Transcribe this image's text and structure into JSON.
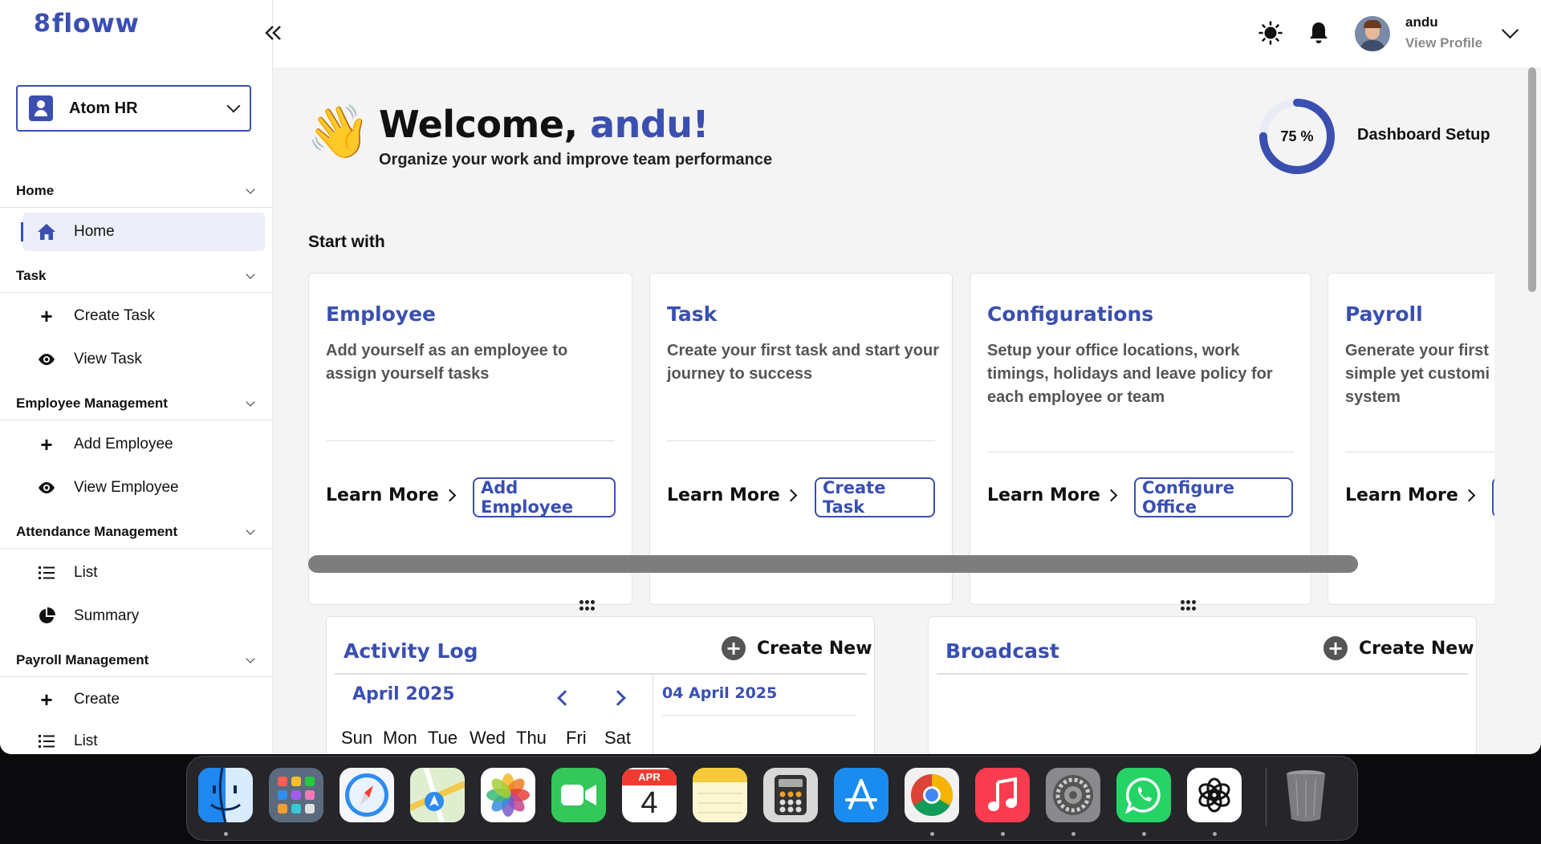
{
  "brand": {
    "mark": "8",
    "name": "floww"
  },
  "org": {
    "name": "Atom HR"
  },
  "sidebar": {
    "sections": [
      {
        "title": "Home",
        "items": [
          {
            "label": "Home",
            "icon": "house-icon"
          }
        ]
      },
      {
        "title": "Task",
        "items": [
          {
            "label": "Create Task",
            "icon": "plus-icon"
          },
          {
            "label": "View Task",
            "icon": "eye-icon"
          }
        ]
      },
      {
        "title": "Employee Management",
        "items": [
          {
            "label": "Add Employee",
            "icon": "plus-icon"
          },
          {
            "label": "View Employee",
            "icon": "eye-icon"
          }
        ]
      },
      {
        "title": "Attendance Management",
        "items": [
          {
            "label": "List",
            "icon": "list-icon"
          },
          {
            "label": "Summary",
            "icon": "pie-chart-icon"
          }
        ]
      },
      {
        "title": "Payroll Management",
        "items": [
          {
            "label": "Create",
            "icon": "plus-icon"
          },
          {
            "label": "List",
            "icon": "list-icon"
          }
        ]
      }
    ]
  },
  "topbar": {
    "user_name": "andu",
    "profile_link": "View Profile",
    "icons": [
      "sun-icon",
      "bell-icon",
      "avatar",
      "chevron-down-icon"
    ]
  },
  "welcome": {
    "greeting": "Welcome, ",
    "user": "andu!",
    "subtitle": "Organize your work and improve team performance",
    "emoji": "👋"
  },
  "setup": {
    "progress_label": "75 %",
    "progress_value": 0.75,
    "label": "Dashboard Setup"
  },
  "start_with": {
    "heading": "Start with",
    "cards": [
      {
        "title": "Employee",
        "desc": "Add yourself as an employee to assign yourself tasks",
        "learn_more": "Learn More",
        "button": "Add Employee"
      },
      {
        "title": "Task",
        "desc": "Create your first task and start your journey to success",
        "learn_more": "Learn More",
        "button": "Create Task"
      },
      {
        "title": "Configurations",
        "desc": "Setup your office locations, work timings, holidays and leave policy for each employee or team",
        "learn_more": "Learn More",
        "button": "Configure Office"
      },
      {
        "title": "Payroll",
        "desc": "Generate your first simple yet customi system",
        "learn_more": "Learn More",
        "button": ""
      }
    ]
  },
  "activity_log": {
    "title": "Activity Log",
    "create_new": "Create New",
    "month": "April 2025",
    "selected_date": "04 April 2025",
    "weekdays": [
      "Sun",
      "Mon",
      "Tue",
      "Wed",
      "Thu",
      "Fri",
      "Sat"
    ]
  },
  "broadcast": {
    "title": "Broadcast",
    "create_new": "Create New"
  },
  "dock": {
    "calendar_month": "APR",
    "calendar_day": "4",
    "apps": [
      "Finder",
      "Launchpad",
      "Safari",
      "Maps",
      "Photos",
      "FaceTime",
      "Calendar",
      "Notes",
      "Calculator",
      "App Store",
      "Chrome",
      "Music",
      "System Settings",
      "WhatsApp",
      "ChatGPT",
      "Trash"
    ]
  },
  "colors": {
    "accent": "#3a4fb0",
    "background": "#f4f4f4"
  }
}
